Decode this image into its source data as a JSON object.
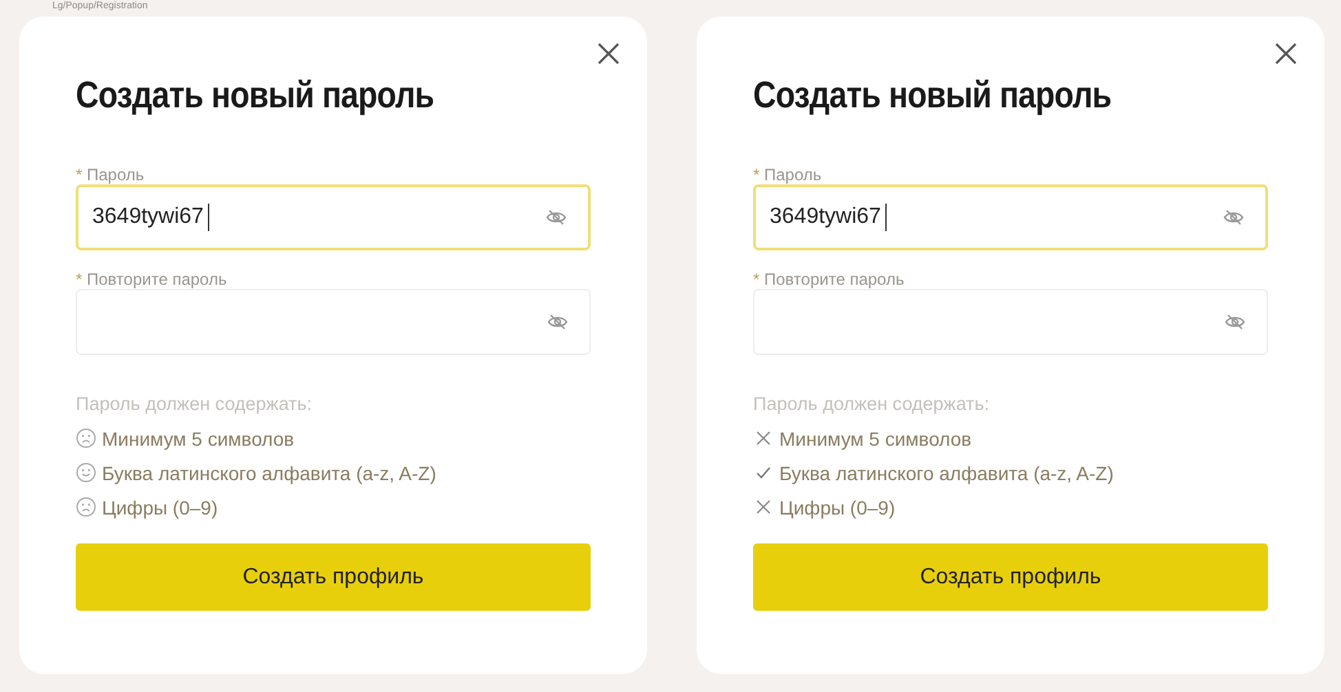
{
  "frame_label": "Lg/Popup/Registration",
  "dialogs": [
    {
      "title": "Создать новый пароль",
      "kind": "face",
      "fields": [
        {
          "marker": "*",
          "label": "Пароль",
          "value": "3649tywi67",
          "focused": true
        },
        {
          "marker": "*",
          "label": "Повторите пароль",
          "focused": false
        }
      ],
      "rules_title": "Пароль должен содержать:",
      "rules": [
        {
          "text": "Минимум 5 символов",
          "met": false
        },
        {
          "text": "Буква латинского алфавита (a-z, A-Z)",
          "met": true
        },
        {
          "text": "Цифры (0–9)",
          "met": false
        }
      ],
      "button": "Создать профиль"
    },
    {
      "title": "Создать новый пароль",
      "kind": "mark",
      "fields": [
        {
          "marker": "*",
          "label": "Пароль",
          "value": "3649tywi67",
          "focused": true
        },
        {
          "marker": "*",
          "label": "Повторите пароль",
          "focused": false
        }
      ],
      "rules_title": "Пароль должен содержать:",
      "rules": [
        {
          "text": "Минимум 5 символов",
          "met": false
        },
        {
          "text": "Буква латинского алфавита (a-z, A-Z)",
          "met": true
        },
        {
          "text": "Цифры (0–9)",
          "met": false
        }
      ],
      "button": "Создать профиль"
    }
  ]
}
